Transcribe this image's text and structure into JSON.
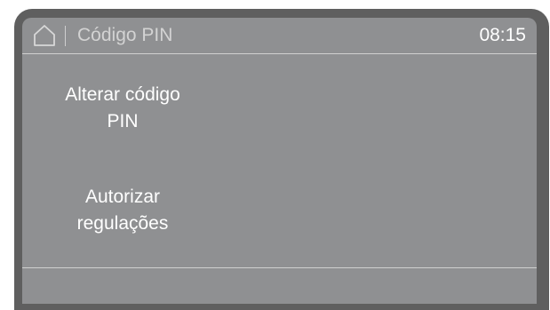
{
  "header": {
    "home_icon": "home-icon",
    "title": "Código PIN",
    "time": "08:15"
  },
  "menu": {
    "items": [
      {
        "line1": "Alterar código",
        "line2": "PIN"
      },
      {
        "line1": "Autorizar",
        "line2": "regulações"
      }
    ]
  },
  "colors": {
    "bezel": "#5f5f5f",
    "screen": "#8f9092",
    "text": "#ffffff",
    "title_text": "#d3d3d3",
    "rule": "#d0d0d0"
  }
}
